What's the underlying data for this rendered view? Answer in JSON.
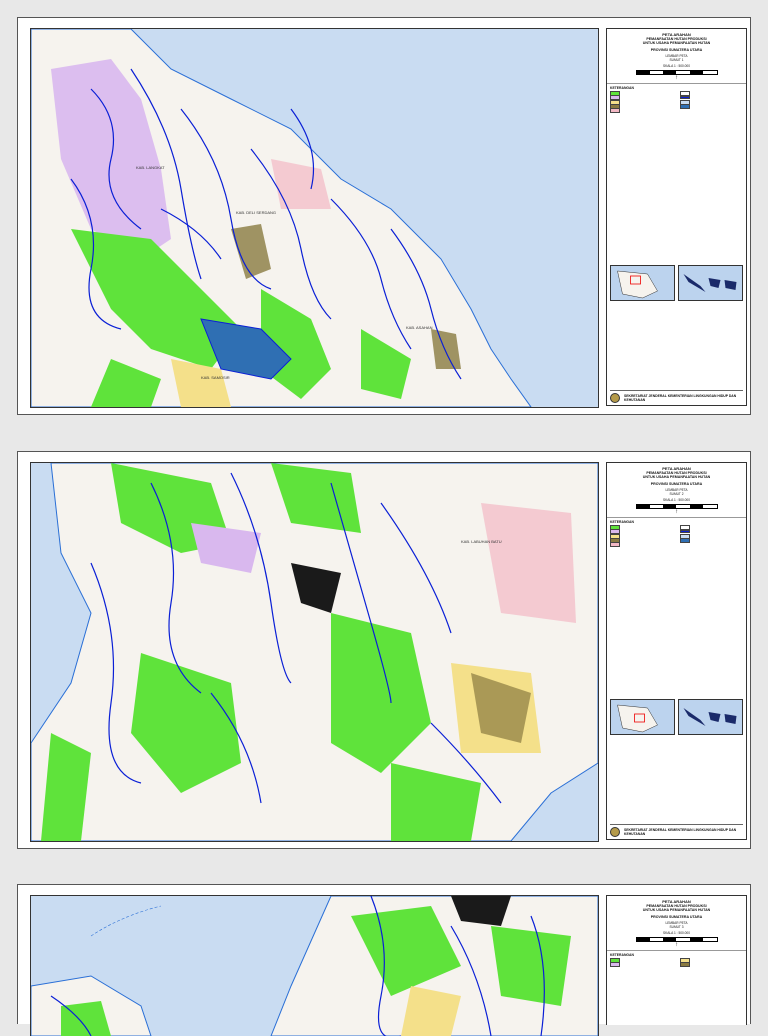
{
  "sheets": [
    {
      "title": "PETA ARAHAN",
      "subtitle1": "PEMANFAATAN HUTAN PRODUKSI",
      "subtitle2": "UNTUK USAHA PEMANFAATAN HUTAN",
      "province": "PROVINSI SUMATERA UTARA",
      "sheet_label": "LEMBAR PETA",
      "sheet_number": "SUMUT 1",
      "scale": "SKALA 1 : 500.000",
      "legend_heading": "KETERANGAN",
      "footer": "SEKRETARIAT JENDERAL KEMENTERIAN LINGKUNGAN HIDUP DAN KEHUTANAN"
    },
    {
      "title": "PETA ARAHAN",
      "subtitle1": "PEMANFAATAN HUTAN PRODUKSI",
      "subtitle2": "UNTUK USAHA PEMANFAATAN HUTAN",
      "province": "PROVINSI SUMATERA UTARA",
      "sheet_label": "LEMBAR PETA",
      "sheet_number": "SUMUT 2",
      "scale": "SKALA 1 : 500.000",
      "legend_heading": "KETERANGAN",
      "footer": "SEKRETARIAT JENDERAL KEMENTERIAN LINGKUNGAN HIDUP DAN KEHUTANAN"
    },
    {
      "title": "PETA ARAHAN",
      "subtitle1": "PEMANFAATAN HUTAN PRODUKSI",
      "subtitle2": "UNTUK USAHA PEMANFAATAN HUTAN",
      "province": "PROVINSI SUMATERA UTARA",
      "sheet_label": "LEMBAR PETA",
      "sheet_number": "SUMUT 3",
      "scale": "SKALA 1 : 500.000",
      "legend_heading": "KETERANGAN",
      "footer": ""
    }
  ],
  "map_labels": {
    "sheet1": [
      "KAB. LANGKAT",
      "KAB. DELI SERDANG",
      "KAB. ASAHAN",
      "KAB. SAMOSIR"
    ],
    "sheet2": [
      "KAB. LABUHAN BATU"
    ]
  },
  "colors": {
    "sea": "#c9dcf2",
    "land": "#f6f3ee",
    "river": "#0a1fd6",
    "green": "#5fe33b",
    "lilac": "#d9b8ee",
    "hatch": "#8a7a40",
    "yellow": "#f4e08a",
    "pink": "#f3b8c4",
    "lake": "#2f6fb3"
  }
}
